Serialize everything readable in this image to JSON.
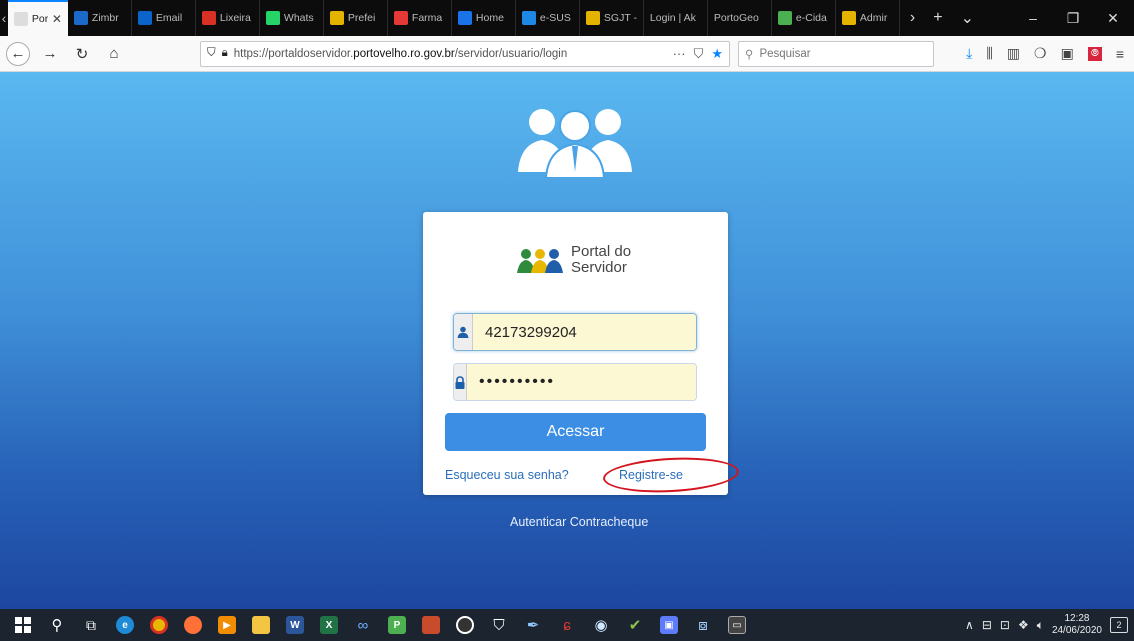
{
  "browser": {
    "tabs": [
      {
        "label": "Portal",
        "icon": "portal-favicon",
        "color": "#f9f9fa",
        "active": true
      },
      {
        "label": "Zimbr",
        "icon": "zimbra-icon",
        "color": "#1b6ac9"
      },
      {
        "label": "Email",
        "icon": "outlook-icon",
        "color": "#0a64c9"
      },
      {
        "label": "Lixeira",
        "icon": "gmail-icon",
        "color": "#d93025"
      },
      {
        "label": "Whats",
        "icon": "whatsapp-icon",
        "color": "#25d366"
      },
      {
        "label": "Prefei",
        "icon": "prefeitura-icon",
        "color": "#e3b300"
      },
      {
        "label": "Farma",
        "icon": "farmacia-icon",
        "color": "#e53935"
      },
      {
        "label": "Home",
        "icon": "page-icon",
        "color": "#1a73e8"
      },
      {
        "label": "e-SUS",
        "icon": "esus-icon",
        "color": "#1e88e5"
      },
      {
        "label": "SGJT -",
        "icon": "sgjt-icon",
        "color": "#e3b300"
      },
      {
        "label": "Login | Ak",
        "icon": "none",
        "color": "#0c0c0d"
      },
      {
        "label": "PortoGeo",
        "icon": "none",
        "color": "#0c0c0d"
      },
      {
        "label": "e-Cida",
        "icon": "ecidade-icon",
        "color": "#4caf50"
      },
      {
        "label": "Admir",
        "icon": "admin-icon",
        "color": "#e3b300"
      }
    ],
    "url": {
      "prefix": "https://portaldoservidor.",
      "domain": "portovelho.ro.gov.br",
      "path": "/servidor/usuario/login"
    },
    "search_placeholder": "Pesquisar"
  },
  "page": {
    "logo_line1": "Portal do",
    "logo_line2": "Servidor",
    "username_value": "42173299204",
    "password_value": "••••••••••",
    "submit_label": "Acessar",
    "forgot_link": "Esqueceu sua senha?",
    "register_link": "Registre-se",
    "contracheque_link": "Autenticar Contracheque",
    "highlight_color": "#d3141f"
  },
  "taskbar": {
    "time": "12:28",
    "date": "24/06/2020",
    "notification_count": "2"
  }
}
